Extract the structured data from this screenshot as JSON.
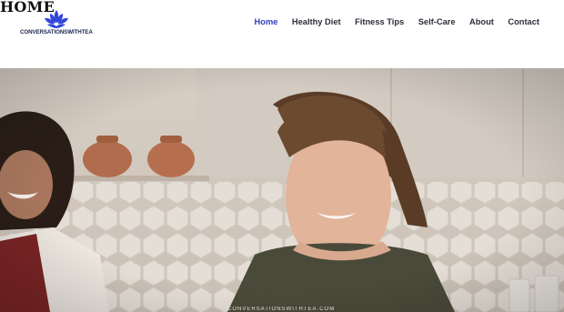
{
  "page": {
    "heading": "HOME"
  },
  "brand": {
    "name": "CONVERSATIONSWITHTEA",
    "accent_color": "#3347d9",
    "icon": "lotus-icon"
  },
  "nav": {
    "items": [
      {
        "label": "Home",
        "active": true
      },
      {
        "label": "Healthy Diet",
        "active": false
      },
      {
        "label": "Fitness Tips",
        "active": false
      },
      {
        "label": "Self-Care",
        "active": false
      },
      {
        "label": "About",
        "active": false
      },
      {
        "label": "Contact",
        "active": false
      }
    ],
    "active_color": "#2d3cbf",
    "text_color": "#2b2f3a"
  },
  "hero": {
    "image": "kitchen-photo-two-women",
    "caption": "CONVERSATIONSWITHTEA.COM"
  }
}
